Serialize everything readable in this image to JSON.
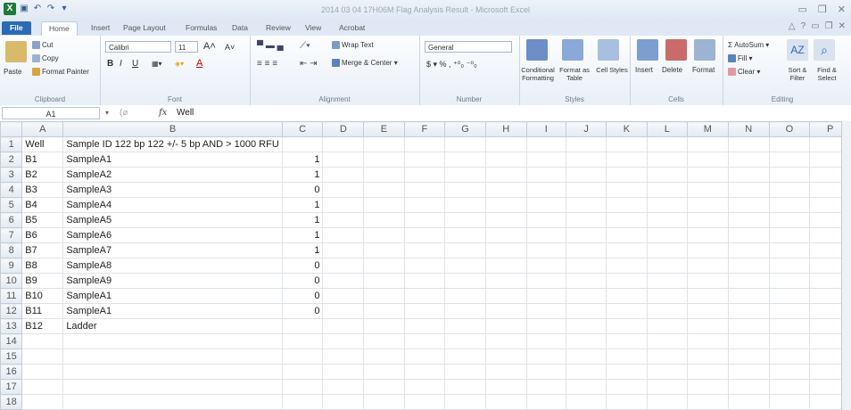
{
  "window": {
    "title": "2014 03 04 17H06M Flag Analysis Result - Microsoft Excel"
  },
  "tabs": [
    "File",
    "Home",
    "Insert",
    "Page Layout",
    "Formulas",
    "Data",
    "Review",
    "View",
    "Acrobat"
  ],
  "ribbon": {
    "clipboard": {
      "paste": "Paste",
      "cut": "Cut",
      "copy": "Copy",
      "format_painter": "Format Painter",
      "label": "Clipboard"
    },
    "font": {
      "name": "Calibri",
      "size": "11",
      "label": "Font"
    },
    "alignment": {
      "wrap": "Wrap Text",
      "merge": "Merge & Center",
      "label": "Alignment"
    },
    "number": {
      "format": "General",
      "label": "Number"
    },
    "styles": {
      "cond": "Conditional Formatting",
      "table": "Format as Table",
      "cell": "Cell Styles",
      "label": "Styles"
    },
    "cells": {
      "insert": "Insert",
      "delete": "Delete",
      "format": "Format",
      "label": "Cells"
    },
    "editing": {
      "autosum": "AutoSum",
      "fill": "Fill",
      "clear": "Clear",
      "sort": "Sort & Filter",
      "find": "Find & Select",
      "label": "Editing"
    }
  },
  "formula_bar": {
    "cell": "A1",
    "value": "Well"
  },
  "columns": [
    "A",
    "B",
    "C",
    "D",
    "E",
    "F",
    "G",
    "H",
    "I",
    "J",
    "K",
    "L",
    "M",
    "N",
    "O",
    "P"
  ],
  "rows": [
    [
      "1",
      "Well",
      "Sample ID 122 bp 122 +/- 5 bp AND > 1000 RFU",
      ""
    ],
    [
      "2",
      "B1",
      "SampleA1",
      "1"
    ],
    [
      "3",
      "B2",
      "SampleA2",
      "1"
    ],
    [
      "4",
      "B3",
      "SampleA3",
      "0"
    ],
    [
      "5",
      "B4",
      "SampleA4",
      "1"
    ],
    [
      "6",
      "B5",
      "SampleA5",
      "1"
    ],
    [
      "7",
      "B6",
      "SampleA6",
      "1"
    ],
    [
      "8",
      "B7",
      "SampleA7",
      "1"
    ],
    [
      "9",
      "B8",
      "SampleA8",
      "0"
    ],
    [
      "10",
      "B9",
      "SampleA9",
      "0"
    ],
    [
      "11",
      "B10",
      "SampleA1",
      "0"
    ],
    [
      "12",
      "B11",
      "SampleA1",
      "0"
    ],
    [
      "13",
      "B12",
      "Ladder",
      ""
    ],
    [
      "14",
      "",
      "",
      ""
    ],
    [
      "15",
      "",
      "",
      ""
    ],
    [
      "16",
      "",
      "",
      ""
    ],
    [
      "17",
      "",
      "",
      ""
    ],
    [
      "18",
      "",
      "",
      ""
    ]
  ]
}
